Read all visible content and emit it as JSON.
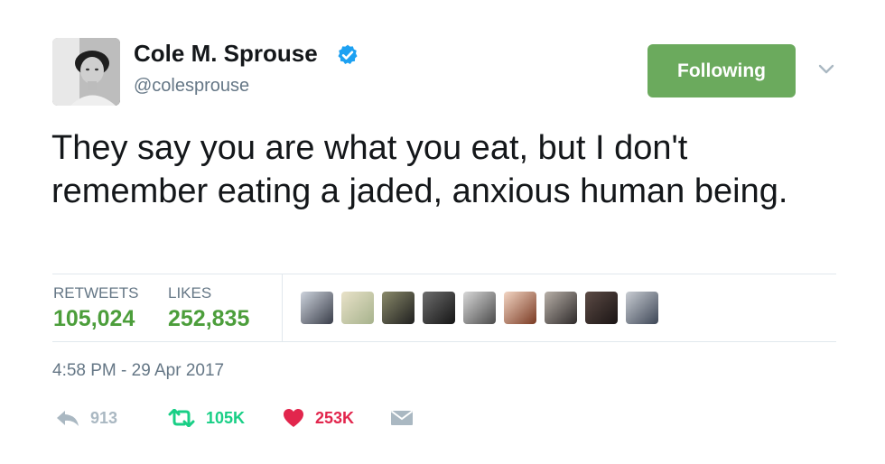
{
  "user": {
    "display_name": "Cole M. Sprouse",
    "handle": "@colesprouse",
    "verified": true,
    "avatar_icon": "profile-photo"
  },
  "follow_button": {
    "label": "Following",
    "color": "#6baa5d"
  },
  "more_menu": {
    "icon": "chevron-down-icon"
  },
  "tweet": {
    "text": "They say you are what you eat, but I don't remember eating a jaded, anxious human being.",
    "timestamp": "4:58 PM - 29 Apr 2017"
  },
  "stats": {
    "retweets_label": "RETWEETS",
    "retweets_value": "105,024",
    "likes_label": "LIKES",
    "likes_value": "252,835",
    "value_color": "#4c9e3b"
  },
  "likers": [
    {
      "icon": "liker-avatar"
    },
    {
      "icon": "liker-avatar"
    },
    {
      "icon": "liker-avatar"
    },
    {
      "icon": "liker-avatar"
    },
    {
      "icon": "liker-avatar"
    },
    {
      "icon": "liker-avatar"
    },
    {
      "icon": "liker-avatar"
    },
    {
      "icon": "liker-avatar"
    },
    {
      "icon": "liker-avatar"
    }
  ],
  "actions": {
    "reply": {
      "icon": "reply-icon",
      "count": "913",
      "color": "#aab8c2"
    },
    "retweet": {
      "icon": "retweet-icon",
      "count": "105K",
      "color": "#19cf86"
    },
    "like": {
      "icon": "heart-icon",
      "count": "253K",
      "color": "#e2264d"
    },
    "message": {
      "icon": "envelope-icon",
      "color": "#aab8c2"
    }
  }
}
